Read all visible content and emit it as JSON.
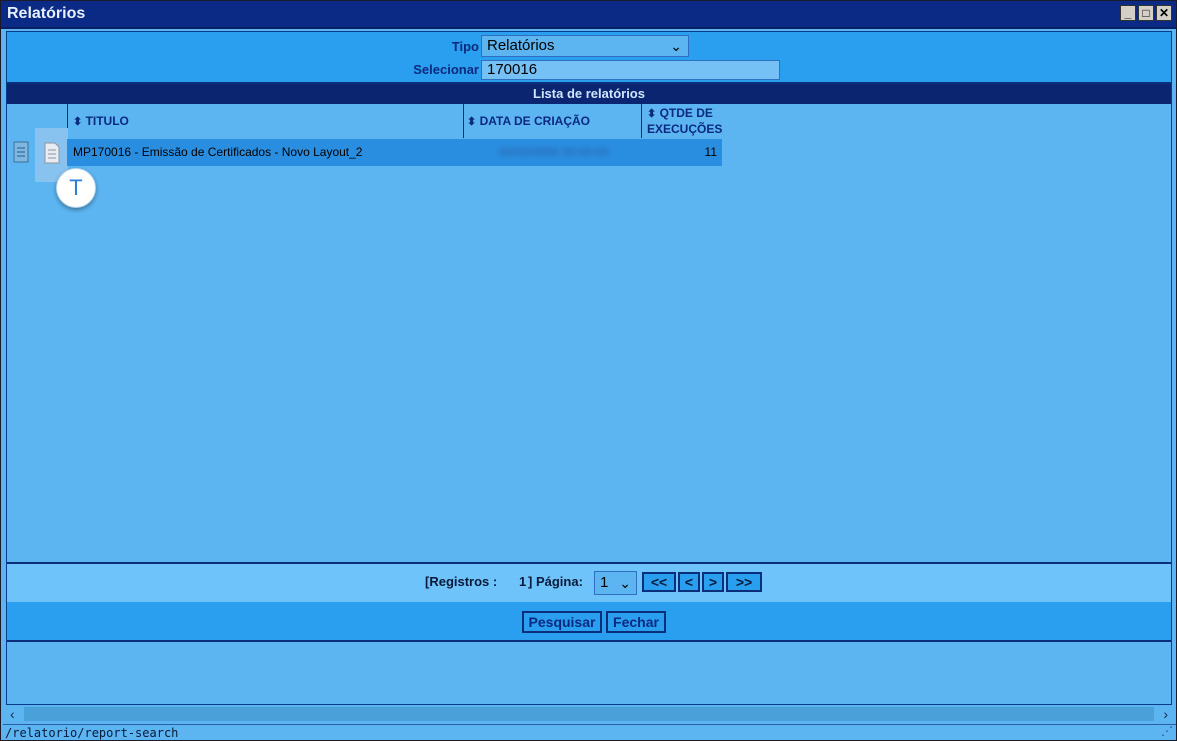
{
  "window": {
    "title": "Relatórios",
    "buttons": {
      "minimize": "_",
      "maximize": "□",
      "close": "✕"
    }
  },
  "filters": {
    "tipo_label": "Tipo",
    "tipo_value": "Relatórios",
    "selecionar_label": "Selecionar",
    "selecionar_value": "170016"
  },
  "list": {
    "header": "Lista de relatórios",
    "columns": {
      "titulo": "TITULO",
      "data_criacao": "DATA DE CRIAÇÃO",
      "qtde_line1": "QTDE DE",
      "qtde_line2": "EXECUÇÕES"
    },
    "sort_icon": "⬍",
    "rows": [
      {
        "titulo": "MP170016 - Emissão de Certificados - Novo Layout_2",
        "data_criacao": "00/00/0000 00:00:00",
        "qtde": "11"
      }
    ],
    "badge": "T"
  },
  "pager": {
    "registros_label": "[Registros :",
    "registros_count": "1",
    "pagina_label": "] Página:",
    "pagina_value": "1",
    "first": "<<",
    "prev": "<",
    "next": ">",
    "last": ">>"
  },
  "actions": {
    "pesquisar": "Pesquisar",
    "fechar": "Fechar"
  },
  "statusbar": {
    "url": "/relatorio/report-search"
  },
  "icons": [
    "document-icon",
    "document-icon",
    "chevron-down-icon",
    "sort-icon",
    "resize-grip-icon"
  ],
  "colors": {
    "titlebar": "#0b2a86",
    "background": "#5cb4f0",
    "accent": "#2a9ff0",
    "header_dark": "#0b2570",
    "selected_row": "#2a8ee0"
  }
}
